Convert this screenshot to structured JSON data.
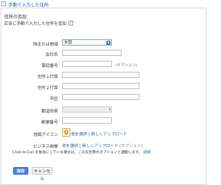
{
  "header": {
    "toggle_symbol": "−",
    "title": "手動で入力した住所"
  },
  "section": {
    "title": "住所の追加",
    "subtitle": "広告に手動で入力した住所を追加",
    "help_symbol": "?"
  },
  "form": {
    "country": {
      "label": "国または地域",
      "value": "米国"
    },
    "company": {
      "label": "会社名",
      "value": ""
    },
    "phone": {
      "label": "電話番号",
      "value": "",
      "optional": "(オプション)"
    },
    "address1": {
      "label": "住所１行目",
      "value": ""
    },
    "address2": {
      "label": "住所２行目",
      "value": ""
    },
    "city": {
      "label": "市区",
      "value": ""
    },
    "state": {
      "label": "都道府県",
      "value": ""
    },
    "postal": {
      "label": "郵便番号",
      "value": ""
    },
    "map_icon": {
      "label": "地図アイコン",
      "select": "他を選択",
      "sep": "|",
      "upload": "新しくアップロード"
    },
    "business_image": {
      "label": "ビジネス画像",
      "select": "他を選択",
      "sep": "|",
      "upload": "新しくアップロード",
      "optional": "(オプション)"
    }
  },
  "notice": {
    "text": "Click-to-Call を有効にしている場合は、この広告表示オプションと連動します。",
    "link": "詳細"
  },
  "buttons": {
    "save": "保存",
    "cancel": "キャンセル"
  },
  "colors": {
    "accent": "#4d7fe0",
    "link": "#1a55b0"
  }
}
